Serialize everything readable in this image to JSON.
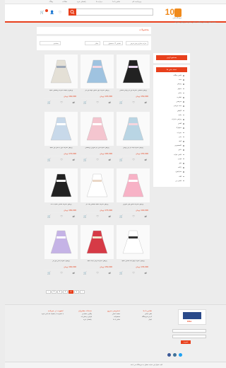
{
  "topbar": {
    "links": [
      "ورود/ثبت نام",
      "تماس با ما",
      "درباره ما",
      "راهنمای خرید",
      "مقالات",
      "وبلاگ"
    ]
  },
  "header": {
    "logo_num": "10",
    "logo_tag": "فروشگاه لباس",
    "search_placeholder": "جستجو...",
    "cart_count": "0"
  },
  "breadcrumb": "صفحه اصلی / لباس بچگانه / لباس دخترانه / پیراهن دخترانه",
  "main": {
    "title": "محصولات",
    "filters": [
      "مرتب سازی پیش فرض",
      "نمایش ۱۲ محصول",
      "فیلتر"
    ],
    "search_placeholder": "جستجو"
  },
  "products": [
    {
      "name": "پیراهن مجلسی دخترانه تور دار پولکی مشکی",
      "price": "150,000 تومان"
    },
    {
      "name": "پیراهن دخترانه جین آستین کوتاه تور دار",
      "price": "145,000 تومان"
    },
    {
      "name": "پیراهن و جلیقه دخترانه پرنسسی سفید",
      "price": "160,000 تومان"
    },
    {
      "name": "پیراهن دخترانه پف دار آبی روشن",
      "price": "155,000 تومان"
    },
    {
      "name": "پیراهن دخترانه تور دار صورتی پرنسسی",
      "price": "165,000 تومان"
    },
    {
      "name": "پیراهن دخترانه جین با دامن تور سفید",
      "price": "170,000 تومان"
    },
    {
      "name": "پیراهن دخترانه آستین پفی صورتی",
      "price": "140,000 تومان"
    },
    {
      "name": "پیراهن دخترانه سفید مجلسی پف دار",
      "price": "175,000 تومان"
    },
    {
      "name": "پیراهن دخترانه مشکی سفید با کت",
      "price": "180,000 تومان"
    },
    {
      "name": "پیراهن دخترانه چهارخانه مشکی سفید",
      "price": "135,000 تومان"
    },
    {
      "name": "پیراهن دخترانه قرمز با یقه سفید",
      "price": "150,000 تومان"
    },
    {
      "name": "پیراهن دخترانه یاسی تور دار",
      "price": "160,000 تومان"
    }
  ],
  "pagination": [
    "›",
    "5",
    "4",
    "3",
    "2",
    "1",
    "‹"
  ],
  "sidebar": {
    "search_button": "جستجو کردن",
    "categories_title": "دسته بندی ها",
    "categories": [
      "لباس بچگانه",
      "ست",
      "پیراهن",
      "شلوار",
      "مانتو",
      "تیشرت",
      "سرهمی",
      "ست نوزادی",
      "کاپشن",
      "بافت",
      "پیراهن دخترانه",
      "کفش",
      "شلوارک",
      "جوراب",
      "بادی",
      "کیف",
      "اکسسوری",
      "دامن",
      "لباس خواب",
      "هودی",
      "بلوز",
      "ژاکت",
      "سارافون",
      "کلاه",
      "لباس زیر"
    ]
  },
  "footer": {
    "columns": [
      {
        "title": "تماس با ما",
        "links": [
          "تلفن تماس",
          "آدرس فروشگاه",
          "ایمیل"
        ]
      },
      {
        "title": "دسترسی سریع",
        "links": [
          "صفحه اصلی",
          "محصولات",
          "تماس با ما"
        ]
      },
      {
        "title": "خدمات مشتریان",
        "links": [
          "پیگیری سفارش",
          "قوانین و مقررات",
          "راهنمای خرید"
        ]
      },
      {
        "title": "عضویت در خبرنامه",
        "links": [
          "با عضویت از تخفیف ها باخبر شوید"
        ]
      }
    ],
    "subscribe_button": "عضویت",
    "copyright": "کلیه حقوق این سایت متعلق به فروشگاه می باشد"
  },
  "colors": {
    "accent": "#e8401c",
    "logo": "#f08a1c"
  }
}
